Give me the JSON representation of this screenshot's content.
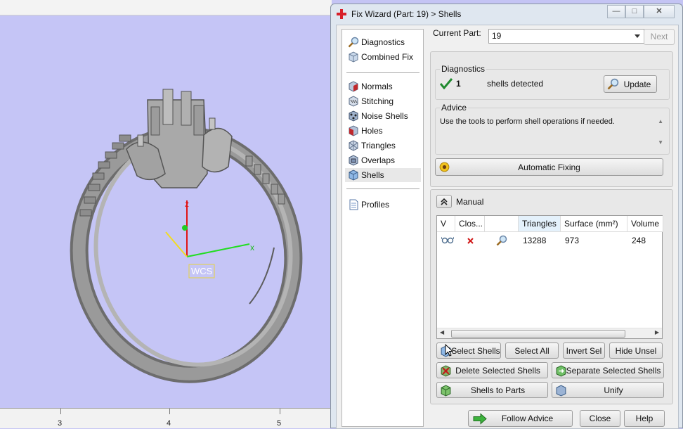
{
  "viewport": {
    "axis_z": "z",
    "axis_x": "x",
    "wcs_label": "WCS",
    "ruler_ticks": [
      "3",
      "4",
      "5"
    ],
    "background_color": "#c5c5f6"
  },
  "dialog": {
    "title": "Fix Wizard (Part: 19) > Shells",
    "window_buttons": [
      "minimize",
      "maximize",
      "close"
    ]
  },
  "nav": {
    "top": [
      {
        "label": "Diagnostics",
        "icon": "magnifier-icon"
      },
      {
        "label": "Combined Fix",
        "icon": "cube-icon"
      }
    ],
    "tools": [
      {
        "label": "Normals",
        "icon": "normals-icon"
      },
      {
        "label": "Stitching",
        "icon": "stitching-icon"
      },
      {
        "label": "Noise Shells",
        "icon": "noise-shells-icon"
      },
      {
        "label": "Holes",
        "icon": "holes-icon"
      },
      {
        "label": "Triangles",
        "icon": "triangles-icon"
      },
      {
        "label": "Overlaps",
        "icon": "overlaps-icon"
      },
      {
        "label": "Shells",
        "icon": "shells-icon",
        "selected": true
      }
    ],
    "profiles": {
      "label": "Profiles",
      "icon": "document-icon"
    }
  },
  "current_part": {
    "label": "Current Part:",
    "value": "19",
    "next_label": "Next"
  },
  "diagnostics": {
    "title": "Diagnostics",
    "count": "1",
    "status": "shells detected",
    "update_label": "Update"
  },
  "advice": {
    "title": "Advice",
    "text": "Use the tools to perform shell operations if needed."
  },
  "automatic_fixing_label": "Automatic Fixing",
  "manual": {
    "label": "Manual",
    "columns": [
      "V",
      "Clos...",
      "",
      "Triangles",
      "Surface (mm²)",
      "Volume"
    ],
    "rows": [
      {
        "triangles": "13288",
        "surface": "973",
        "volume": "248"
      }
    ],
    "buttons": {
      "select_shells": "Select Shells",
      "select_all": "Select All",
      "invert_sel": "Invert Sel",
      "hide_unsel": "Hide Unsel",
      "delete_selected": "Delete Selected Shells",
      "separate_selected": "Separate Selected Shells",
      "shells_to_parts": "Shells to Parts",
      "unify": "Unify"
    }
  },
  "footer": {
    "follow_advice": "Follow Advice",
    "close": "Close",
    "help": "Help"
  }
}
